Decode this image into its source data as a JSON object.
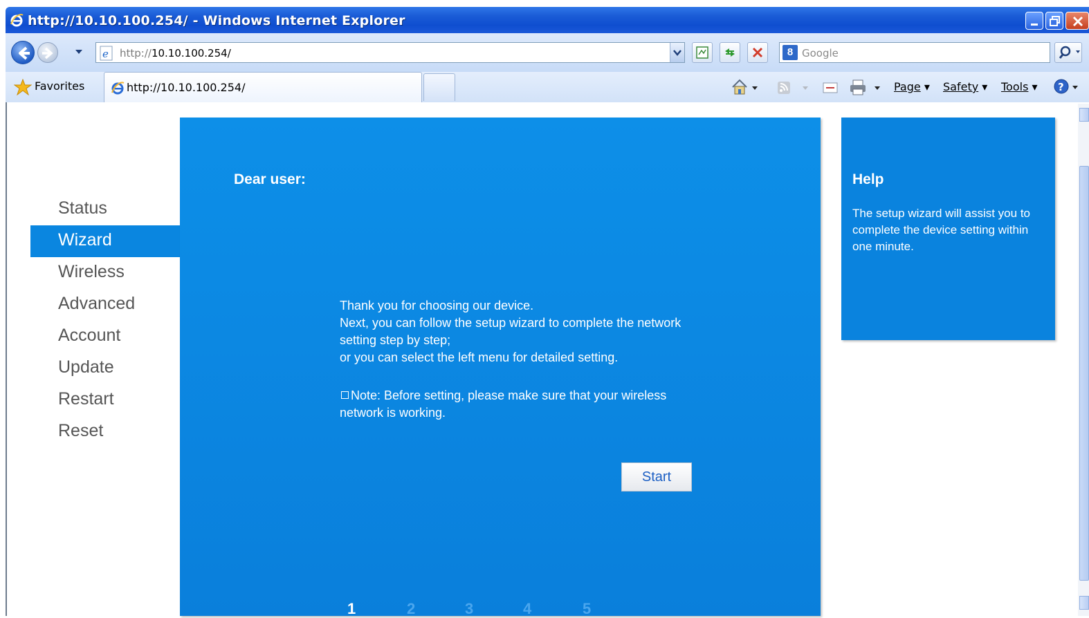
{
  "window": {
    "title": "http://10.10.100.254/ - Windows Internet Explorer"
  },
  "address_bar": {
    "protocol": "http://",
    "host": "10.10.100.254/"
  },
  "search": {
    "placeholder": "Google",
    "engine_icon_letter": "8"
  },
  "favorites_bar": {
    "favorites_label": "Favorites",
    "tab_title": "http://10.10.100.254/"
  },
  "command_bar": {
    "page_label": "Page",
    "safety_label": "Safety",
    "tools_label": "Tools"
  },
  "sidebar": {
    "items": [
      {
        "label": "Status",
        "active": false
      },
      {
        "label": "Wizard",
        "active": true
      },
      {
        "label": "Wireless",
        "active": false
      },
      {
        "label": "Advanced",
        "active": false
      },
      {
        "label": "Account",
        "active": false
      },
      {
        "label": "Update",
        "active": false
      },
      {
        "label": "Restart",
        "active": false
      },
      {
        "label": "Reset",
        "active": false
      }
    ]
  },
  "main": {
    "greeting": "Dear user:",
    "intro_lines": [
      "Thank you for choosing our device.",
      "Next, you can follow the setup wizard to complete the network setting step by step;",
      "or you can select the left menu for detailed setting."
    ],
    "note": "Note: Before setting, please make sure that your wireless network is working.",
    "start_button": "Start",
    "steps": [
      "1",
      "2",
      "3",
      "4",
      "5"
    ],
    "current_step": 1
  },
  "help": {
    "title": "Help",
    "text": "The setup wizard will assist you to complete the device setting within one minute."
  },
  "colors": {
    "panel_blue": "#0a86e0",
    "menu_text": "#555555",
    "titlebar": "#1a5bd6"
  }
}
